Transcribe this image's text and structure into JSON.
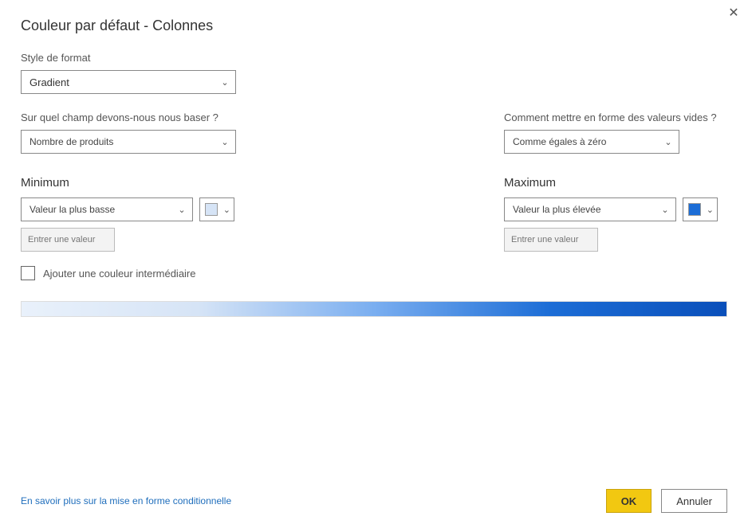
{
  "dialog": {
    "title": "Couleur par défaut - Colonnes"
  },
  "formatStyle": {
    "label": "Style de format",
    "value": "Gradient"
  },
  "basedOnField": {
    "label": "Sur quel champ devons-nous nous baser ?",
    "value": "Nombre de produits"
  },
  "emptyValues": {
    "label": "Comment mettre en forme des valeurs vides ?",
    "value": "Comme égales à zéro"
  },
  "minimum": {
    "label": "Minimum",
    "dropdown": "Valeur la plus basse",
    "placeholder": "Entrer une valeur",
    "color": "#d6e4f6"
  },
  "maximum": {
    "label": "Maximum",
    "dropdown": "Valeur la plus élevée",
    "placeholder": "Entrer une valeur",
    "color": "#1c6dd6"
  },
  "intermediate": {
    "label": "Ajouter une couleur intermédiaire",
    "checked": false
  },
  "footer": {
    "link": "En savoir plus sur la mise en forme conditionnelle",
    "ok": "OK",
    "cancel": "Annuler"
  }
}
